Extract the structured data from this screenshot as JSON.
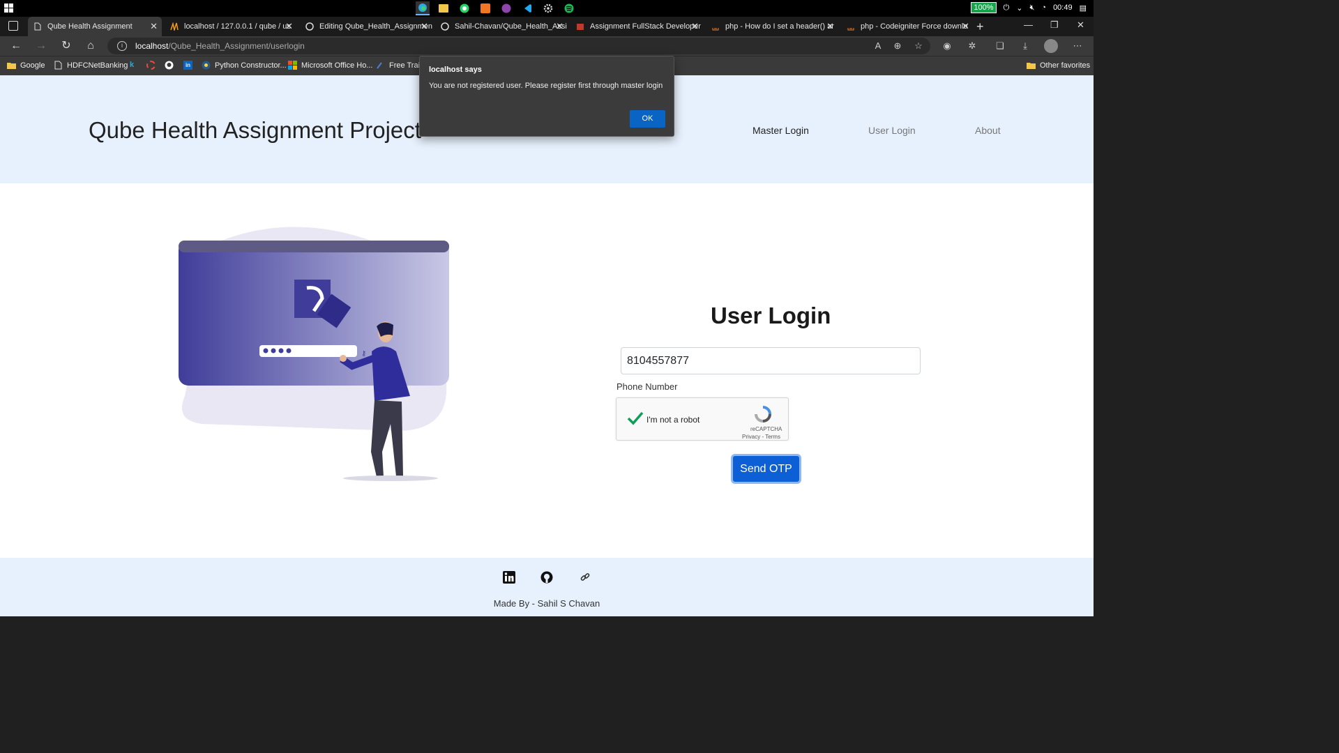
{
  "taskbar": {
    "battery": "100%",
    "clock": "00:49"
  },
  "browser": {
    "tabs": [
      {
        "title": "Qube Health Assignment"
      },
      {
        "title": "localhost / 127.0.0.1 / qube / us"
      },
      {
        "title": "Editing Qube_Health_Assignmen"
      },
      {
        "title": "Sahil-Chavan/Qube_Health_Assi"
      },
      {
        "title": "Assignment FullStack Developer"
      },
      {
        "title": "php - How do I set a header() ar"
      },
      {
        "title": "php - Codeigniter Force downlo"
      }
    ],
    "url_host": "localhost",
    "url_path": "/Qube_Health_Assignment/userlogin",
    "bookmarks": [
      {
        "label": "Google"
      },
      {
        "label": "HDFCNetBanking"
      },
      {
        "label": "k"
      },
      {
        "label": "Python Constructor..."
      },
      {
        "label": "Microsoft Office Ho..."
      },
      {
        "label": "Free Traini"
      }
    ],
    "other_favorites": "Other favorites"
  },
  "site": {
    "brand": "Qube Health Assignment Project",
    "nav": [
      {
        "label": "Master Login"
      },
      {
        "label": "User Login"
      },
      {
        "label": "About"
      }
    ]
  },
  "login": {
    "title": "User Login",
    "phone_value": "8104557877",
    "phone_label": "Phone Number",
    "captcha_text": "I'm not a robot",
    "captcha_brand": "reCAPTCHA",
    "captcha_links": "Privacy - Terms",
    "send_button": "Send OTP"
  },
  "footer": {
    "made_by": "Made By - Sahil S Chavan"
  },
  "dialog": {
    "title": "localhost says",
    "message": "You are not registered user. Please register first through master login",
    "ok": "OK"
  },
  "colors": {
    "header_bg": "#e7f1fd",
    "primary": "#0d5fd6",
    "illustration": "#3f3d99"
  }
}
